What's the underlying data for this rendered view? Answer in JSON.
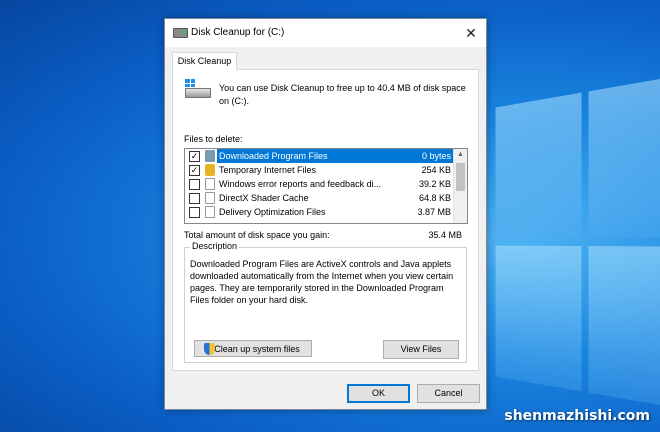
{
  "window": {
    "title": "Disk Cleanup for  (C:)",
    "close_glyph": "✕"
  },
  "tabs": [
    {
      "label": "Disk Cleanup"
    }
  ],
  "info": {
    "text": "You can use Disk Cleanup to free up to 40.4 MB of disk space on  (C:)."
  },
  "files_label": "Files to delete:",
  "files": [
    {
      "name": "Downloaded Program Files",
      "size": "0 bytes",
      "checked": true,
      "selected": true,
      "icon": "folder-icon"
    },
    {
      "name": "Temporary Internet Files",
      "size": "254 KB",
      "checked": true,
      "selected": false,
      "icon": "lock-icon"
    },
    {
      "name": "Windows error reports and feedback di...",
      "size": "39.2 KB",
      "checked": false,
      "selected": false,
      "icon": "file-icon"
    },
    {
      "name": "DirectX Shader Cache",
      "size": "64.8 KB",
      "checked": false,
      "selected": false,
      "icon": "file-icon"
    },
    {
      "name": "Delivery Optimization Files",
      "size": "3.87 MB",
      "checked": false,
      "selected": false,
      "icon": "file-icon"
    }
  ],
  "total": {
    "label": "Total amount of disk space you gain:",
    "value": "35.4 MB"
  },
  "description": {
    "title": "Description",
    "text": "Downloaded Program Files are ActiveX controls and Java applets downloaded automatically from the Internet when you view certain pages. They are temporarily stored in the Downloaded Program Files folder on your hard disk."
  },
  "buttons": {
    "cleanup": "Clean up system files",
    "view": "View Files",
    "ok": "OK",
    "cancel": "Cancel"
  },
  "watermark": "shenmazhishi.com",
  "colors": {
    "selection": "#0078d7",
    "desktop": "#0b5fc7"
  }
}
